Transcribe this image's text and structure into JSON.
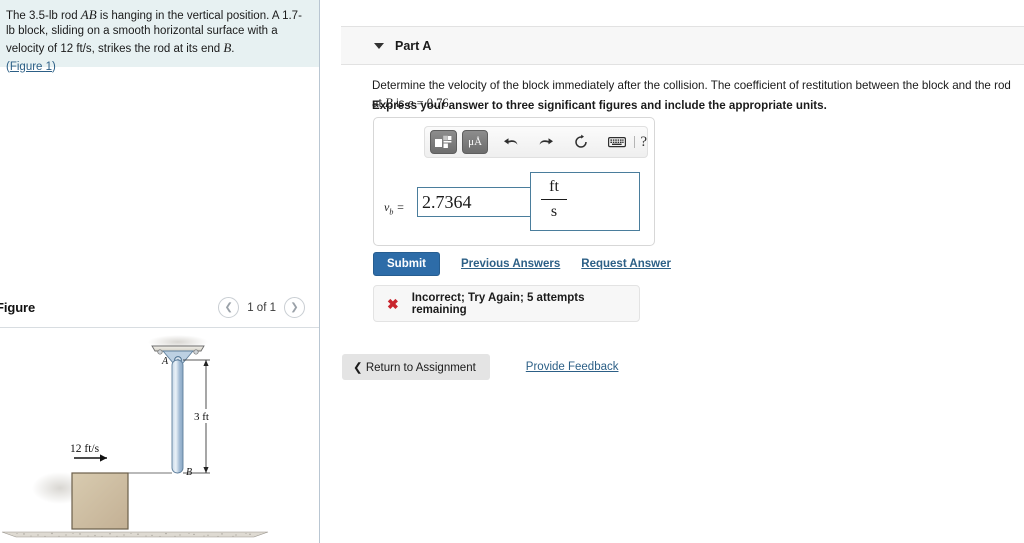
{
  "problem": {
    "text_part1": "The 3.5-lb rod ",
    "var_ab": "AB",
    "text_part2": " is hanging in the vertical position. A 1.7-lb block, sliding on a smooth horizontal surface with a velocity of 12 ft/s, strikes the rod at its end ",
    "var_b": "B",
    "text_part3": ".",
    "figure_link_open": "(",
    "figure_link": "Figure 1",
    "figure_link_close": ")"
  },
  "figure": {
    "title": "Figure",
    "pager_label": "1 of 1",
    "prev_icon": "chevron-left-icon",
    "next_icon": "chevron-right-icon",
    "labels": {
      "point_a": "A",
      "point_b": "B",
      "dimension": "3 ft",
      "velocity": "12 ft/s"
    },
    "colors": {
      "rod": "#a9c4dd",
      "block": "#cdbda0",
      "ground": "#d7d3cc"
    }
  },
  "part": {
    "caret_icon": "chevron-down-icon",
    "title": "Part A",
    "question_part1": "Determine the velocity of the block immediately after the collision. The coefficient of restitution between the block and the rod at ",
    "question_var_b": "B",
    "question_part2": " is ",
    "question_var_e": "e",
    "question_part3": " = 0.76.",
    "instruction": "Express your answer to three significant figures and include the appropriate units."
  },
  "answer": {
    "toolbar": {
      "template_icon": "template-grid-icon",
      "units_icon": "micro-angstrom-icon",
      "units_label": "μÅ",
      "undo_icon": "undo-arrow-icon",
      "redo_icon": "redo-arrow-icon",
      "reset_icon": "reset-circle-icon",
      "keyboard_icon": "keyboard-icon",
      "help_label": "?"
    },
    "label_var": "v",
    "label_sub": "b",
    "label_eq": " =",
    "value": "2.7364",
    "placeholder": "",
    "unit_numerator": "ft",
    "unit_denominator": "s"
  },
  "actions": {
    "submit_label": "Submit",
    "previous_answers_label": "Previous Answers",
    "request_answer_label": "Request Answer"
  },
  "feedback": {
    "icon": "error-x-icon",
    "message": "Incorrect; Try Again; 5 attempts remaining",
    "color": "#c9252d"
  },
  "footer": {
    "return_icon": "chevron-left-icon",
    "return_label": "Return to Assignment",
    "provide_feedback_label": "Provide Feedback"
  }
}
